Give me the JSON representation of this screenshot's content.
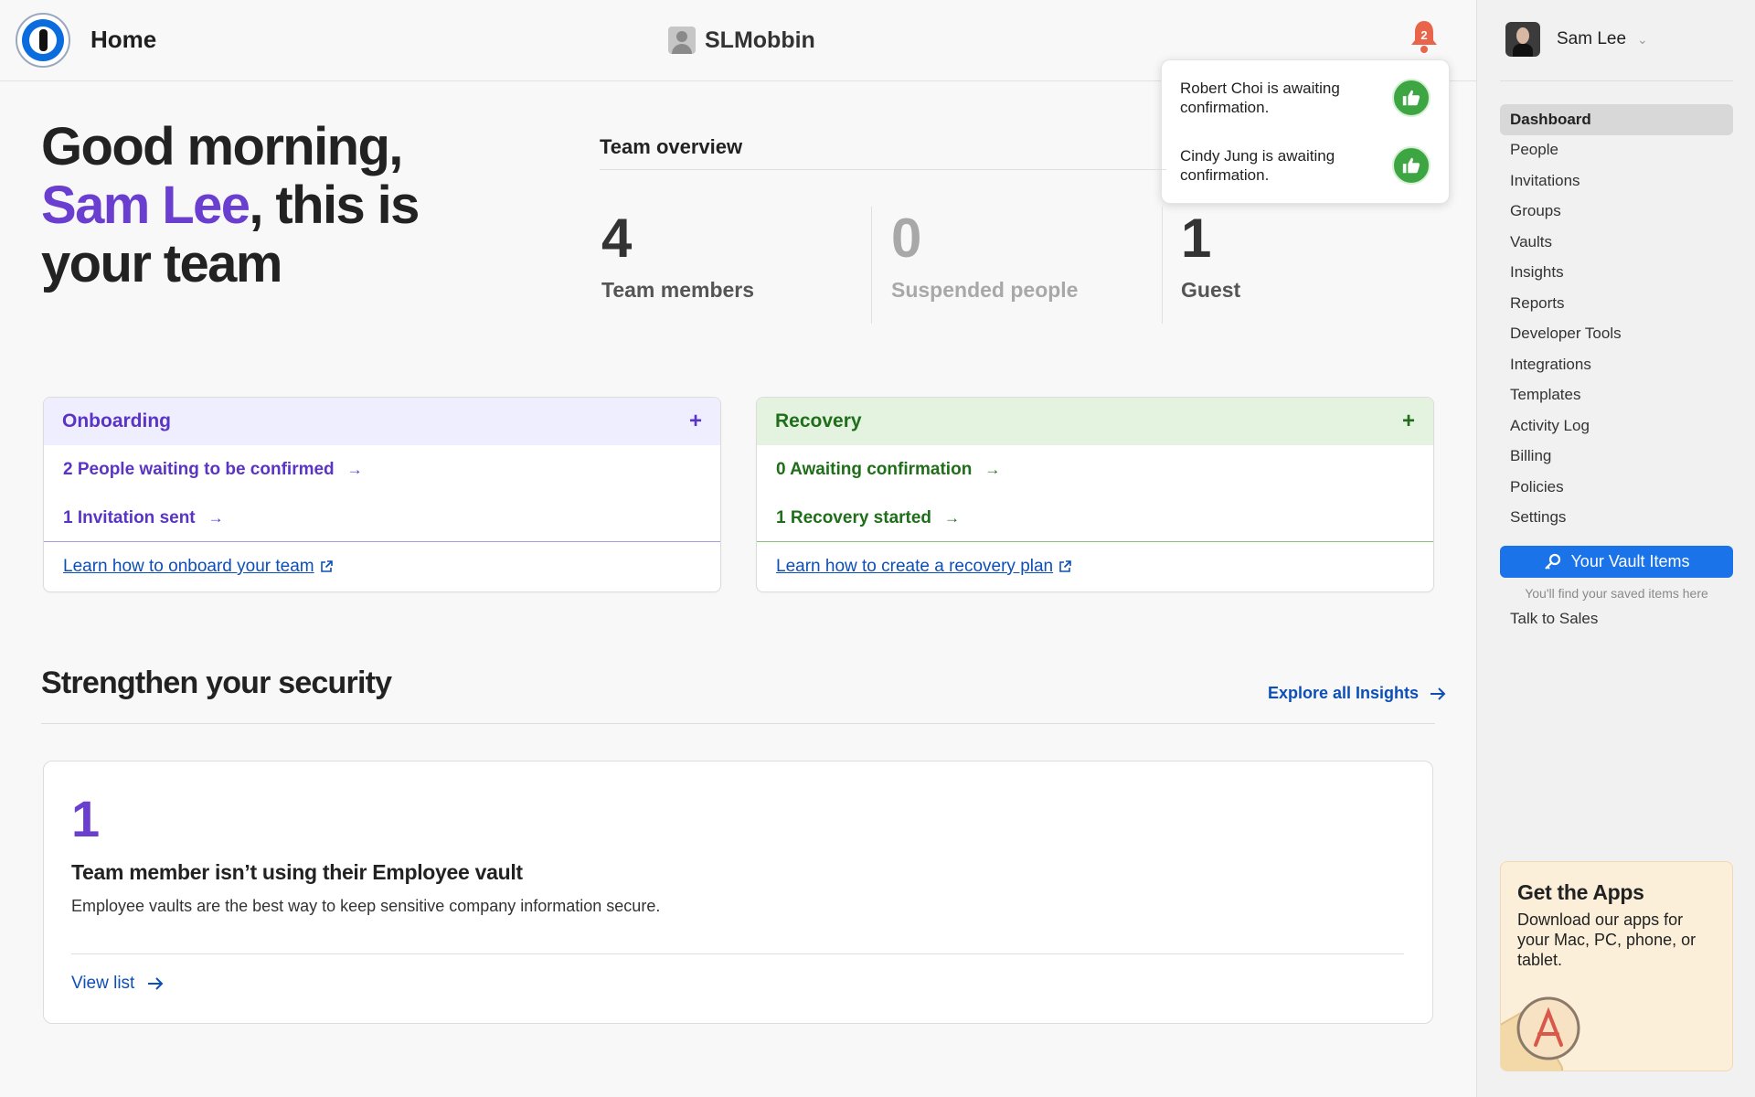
{
  "header": {
    "title": "Home",
    "account_name": "SLMobbin",
    "notification_count": "2"
  },
  "notifications": [
    {
      "text": "Robert Choi is awaiting confirmation."
    },
    {
      "text": "Cindy Jung is awaiting confirmation."
    }
  ],
  "greeting": {
    "prefix": "Good morning, ",
    "name": "Sam Lee",
    "suffix": ", this is your team"
  },
  "overview": {
    "title": "Team overview",
    "stats": [
      {
        "value": "4",
        "label": "Team members"
      },
      {
        "value": "0",
        "label": "Suspended people"
      },
      {
        "value": "1",
        "label": "Guest"
      }
    ]
  },
  "onboarding": {
    "title": "Onboarding",
    "plus": "+",
    "rows": [
      "2 People waiting to be confirmed",
      "1 Invitation sent"
    ],
    "link": "Learn how to onboard your team"
  },
  "recovery": {
    "title": "Recovery",
    "plus": "+",
    "rows": [
      "0 Awaiting confirmation",
      "1 Recovery started"
    ],
    "link": "Learn how to create a recovery plan"
  },
  "security": {
    "title": "Strengthen your security",
    "explore_link": "Explore all Insights",
    "insight": {
      "count": "1",
      "title": "Team member isn’t using their Employee vault",
      "description": "Employee vaults are the best way to keep sensitive company information secure.",
      "link": "View list"
    }
  },
  "sidebar": {
    "user_name": "Sam Lee",
    "items": [
      {
        "label": "Dashboard"
      },
      {
        "label": "People"
      },
      {
        "label": "Invitations"
      },
      {
        "label": "Groups"
      },
      {
        "label": "Vaults"
      },
      {
        "label": "Insights"
      },
      {
        "label": "Reports"
      },
      {
        "label": "Developer Tools"
      },
      {
        "label": "Integrations"
      },
      {
        "label": "Templates"
      },
      {
        "label": "Activity Log"
      },
      {
        "label": "Billing"
      },
      {
        "label": "Policies"
      },
      {
        "label": "Settings"
      }
    ],
    "vault_button": "Your Vault Items",
    "vault_hint": "You'll find your saved items here",
    "talk_to_sales": "Talk to Sales",
    "apps": {
      "title": "Get the Apps",
      "description": "Download our apps for your Mac, PC, phone, or tablet."
    }
  },
  "colors": {
    "accent_purple": "#6a3fd0",
    "accent_green": "#1f6e1a",
    "link_blue": "#0c4fb8",
    "button_blue": "#1a73e8",
    "bell_red": "#e8644a"
  },
  "icons": {
    "logo": "onepassword-logo-icon",
    "bell": "bell-icon",
    "thumb": "thumbs-up-icon",
    "arrow": "arrow-right-icon",
    "external": "external-link-icon",
    "key": "key-icon",
    "chevron": "chevron-down-icon"
  }
}
